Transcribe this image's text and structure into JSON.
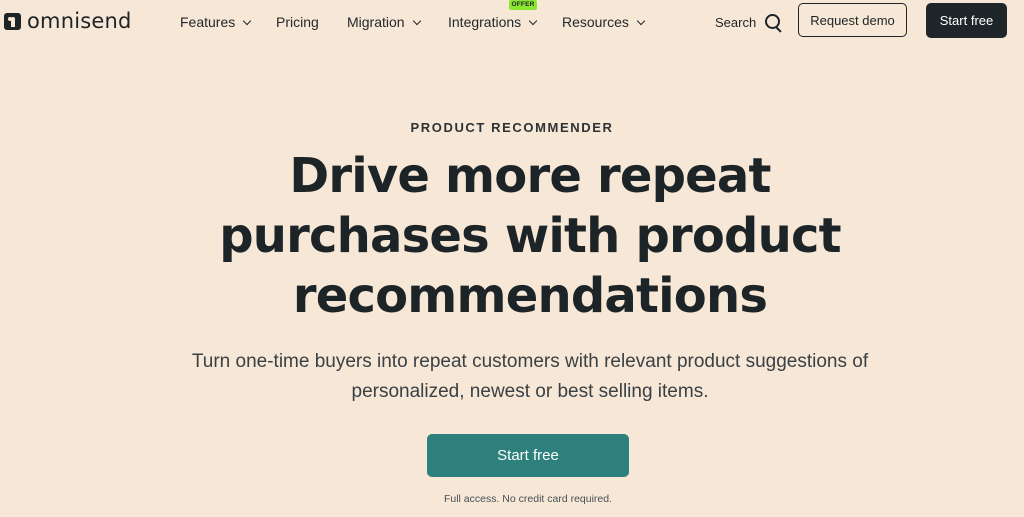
{
  "header": {
    "logo_text": "omnisend",
    "nav": [
      {
        "label": "Features",
        "has_dropdown": true
      },
      {
        "label": "Pricing",
        "has_dropdown": false
      },
      {
        "label": "Migration",
        "has_dropdown": true
      },
      {
        "label": "Integrations",
        "has_dropdown": true,
        "badge": "OFFER"
      },
      {
        "label": "Resources",
        "has_dropdown": true
      }
    ],
    "search_label": "Search",
    "request_demo_label": "Request demo",
    "start_free_label": "Start free"
  },
  "hero": {
    "eyebrow": "PRODUCT RECOMMENDER",
    "title": "Drive more repeat purchases with product recommendations",
    "subtitle": "Turn one-time buyers into repeat customers with relevant product suggestions of personalized, newest or best selling items.",
    "cta_label": "Start free",
    "fine_print": "Full access. No credit card required."
  },
  "colors": {
    "background": "#f6e7d6",
    "text_dark": "#1d2427",
    "cta_teal": "#2e807c",
    "offer_green": "#8ae62f"
  },
  "icons": {
    "logo": "omnisend-logo-icon",
    "search": "search-icon",
    "dropdown": "chevron-down-icon"
  }
}
